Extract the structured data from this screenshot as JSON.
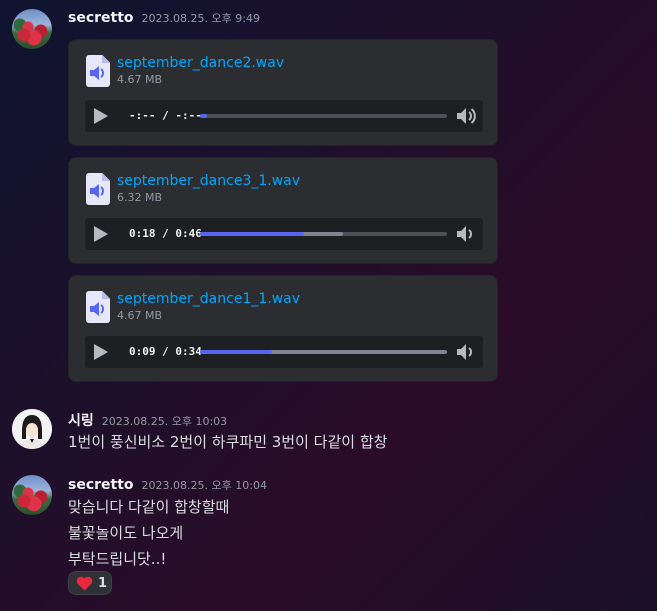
{
  "messages": [
    {
      "username": "secretto",
      "timestamp": "2023.08.25. 오후 9:49",
      "attachments": [
        {
          "name": "september_dance2.wav",
          "size": "4.67 MB",
          "time": "-:-- / -:--",
          "progress": 0.0,
          "buffered": 0.0
        },
        {
          "name": "september_dance3_1.wav",
          "size": "6.32 MB",
          "time": "0:18 / 0:46",
          "progress": 0.42,
          "buffered": 0.58
        },
        {
          "name": "september_dance1_1.wav",
          "size": "4.67 MB",
          "time": "0:09 / 0:34",
          "progress": 0.29,
          "buffered": 1.0
        }
      ]
    },
    {
      "username": "시링",
      "timestamp": "2023.08.25. 오후 10:03",
      "lines": [
        "1번이 풍신비소 2번이 하쿠파민 3번이 다같이 합창"
      ]
    },
    {
      "username": "secretto",
      "timestamp": "2023.08.25. 오후 10:04",
      "lines": [
        "맞습니다 다같이 합창할때",
        "불꽃놀이도 나오게",
        "부탁드립니닷..!"
      ],
      "reaction": {
        "emoji": "heart-icon",
        "count": "1"
      }
    }
  ],
  "colors": {
    "link": "#00a8fc",
    "progress": "#5865f2",
    "heart": "#e8293b"
  }
}
